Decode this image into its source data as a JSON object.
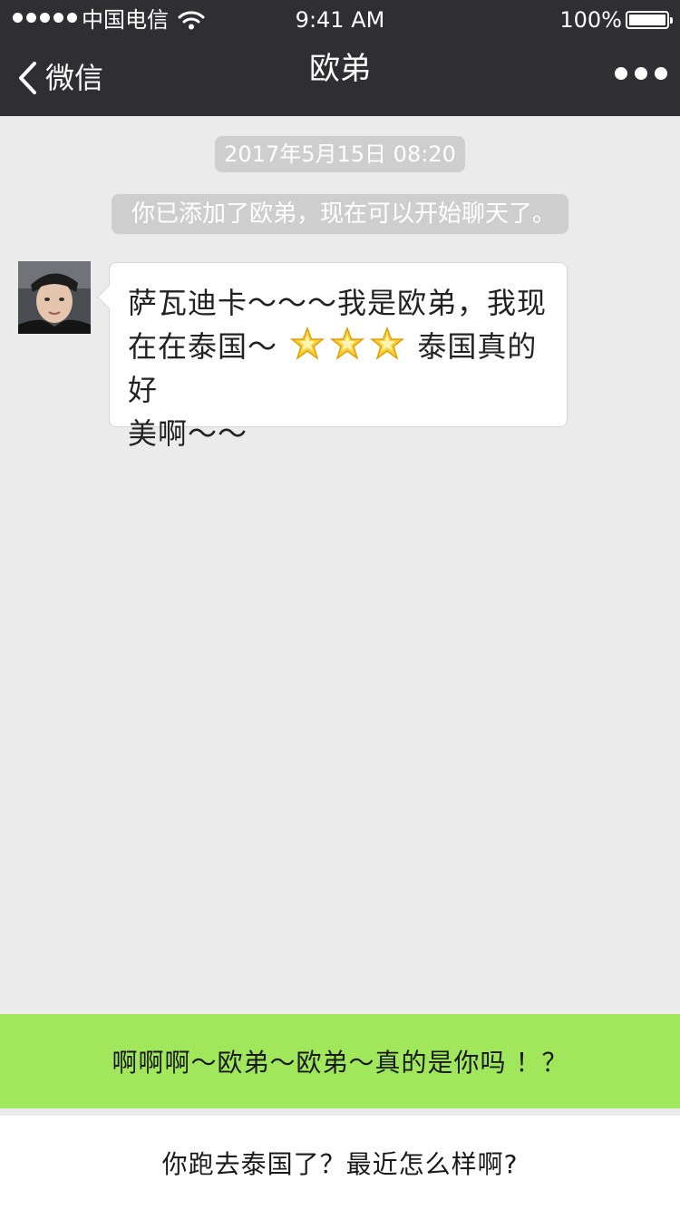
{
  "status_bar": {
    "carrier": "中国电信",
    "time": "9:41 AM",
    "battery": "100%"
  },
  "nav": {
    "back_label": "微信",
    "title": "欧弟"
  },
  "chat": {
    "timestamp": "2017年5月15日  08:20",
    "system_notice": "你已添加了欧弟，现在可以开始聊天了。",
    "message": {
      "line1": "萨瓦迪卡～～～我是欧弟，我现",
      "line2_before": "在在泰国～",
      "line2_after": "泰国真的好",
      "line3": "美啊～～",
      "emoji": "glowing-star-emoji"
    }
  },
  "reply_options": [
    {
      "label": "啊啊啊～欧弟～欧弟～真的是你吗 ！？",
      "selected": true
    },
    {
      "label": "你跑去泰国了？最近怎么样啊?",
      "selected": false
    }
  ],
  "colors": {
    "nav_bg": "#2f2e33",
    "chat_bg": "#ebebeb",
    "selected_option": "#a0e75b",
    "system_pill": "#cecece"
  }
}
